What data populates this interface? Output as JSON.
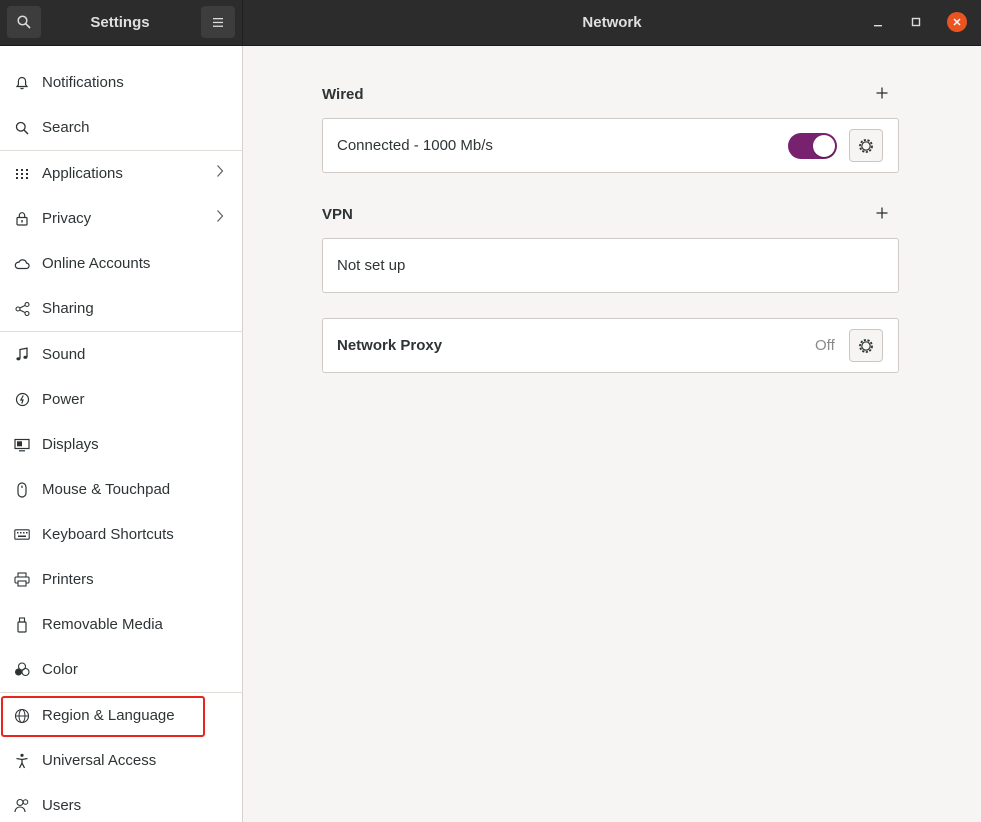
{
  "app": {
    "left_title": "Settings",
    "main_title": "Network"
  },
  "sidebar": {
    "items": [
      {
        "label": "Notifications",
        "icon": "bell-icon"
      },
      {
        "label": "Search",
        "icon": "search-icon"
      },
      {
        "label": "Applications",
        "icon": "grid-icon",
        "chevron": true
      },
      {
        "label": "Privacy",
        "icon": "lock-icon",
        "chevron": true
      },
      {
        "label": "Online Accounts",
        "icon": "cloud-icon"
      },
      {
        "label": "Sharing",
        "icon": "share-icon"
      },
      {
        "label": "Sound",
        "icon": "music-note-icon"
      },
      {
        "label": "Power",
        "icon": "power-icon"
      },
      {
        "label": "Displays",
        "icon": "display-icon"
      },
      {
        "label": "Mouse & Touchpad",
        "icon": "mouse-icon"
      },
      {
        "label": "Keyboard Shortcuts",
        "icon": "keyboard-icon"
      },
      {
        "label": "Printers",
        "icon": "printer-icon"
      },
      {
        "label": "Removable Media",
        "icon": "usb-icon"
      },
      {
        "label": "Color",
        "icon": "color-icon"
      },
      {
        "label": "Region & Language",
        "icon": "globe-icon",
        "highlighted": true
      },
      {
        "label": "Universal Access",
        "icon": "accessibility-icon"
      },
      {
        "label": "Users",
        "icon": "users-icon"
      }
    ]
  },
  "network": {
    "wired": {
      "title": "Wired",
      "status": "Connected - 1000 Mb/s",
      "toggle_on": true
    },
    "vpn": {
      "title": "VPN",
      "status": "Not set up"
    },
    "proxy": {
      "label": "Network Proxy",
      "status": "Off"
    }
  },
  "colors": {
    "accent": "#77216f",
    "close_button": "#e95420",
    "highlight_box": "#e8261e"
  }
}
